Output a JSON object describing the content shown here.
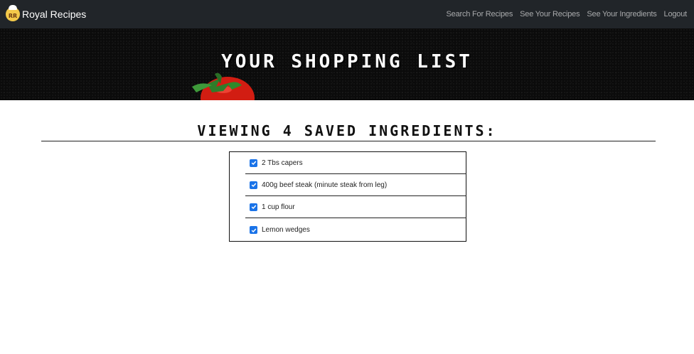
{
  "navbar": {
    "brand_logo_text": "RR",
    "brand_name": "Royal Recipes",
    "links": [
      {
        "label": "Search For Recipes"
      },
      {
        "label": "See Your Recipes"
      },
      {
        "label": "See Your Ingredients"
      },
      {
        "label": "Logout"
      }
    ]
  },
  "hero": {
    "title": "YOUR SHOPPING LIST",
    "image_icon": "tomato-image"
  },
  "main": {
    "heading": "VIEWING 4 SAVED INGREDIENTS:",
    "items": [
      {
        "label": "2 Tbs capers",
        "checked": true
      },
      {
        "label": "400g beef steak (minute steak from leg)",
        "checked": true
      },
      {
        "label": "1 cup flour",
        "checked": true
      },
      {
        "label": "Lemon wedges",
        "checked": true
      }
    ]
  },
  "colors": {
    "navbar_bg": "#212529",
    "checkbox_accent": "#1a73e8",
    "hero_bg": "#0b0b0b"
  }
}
